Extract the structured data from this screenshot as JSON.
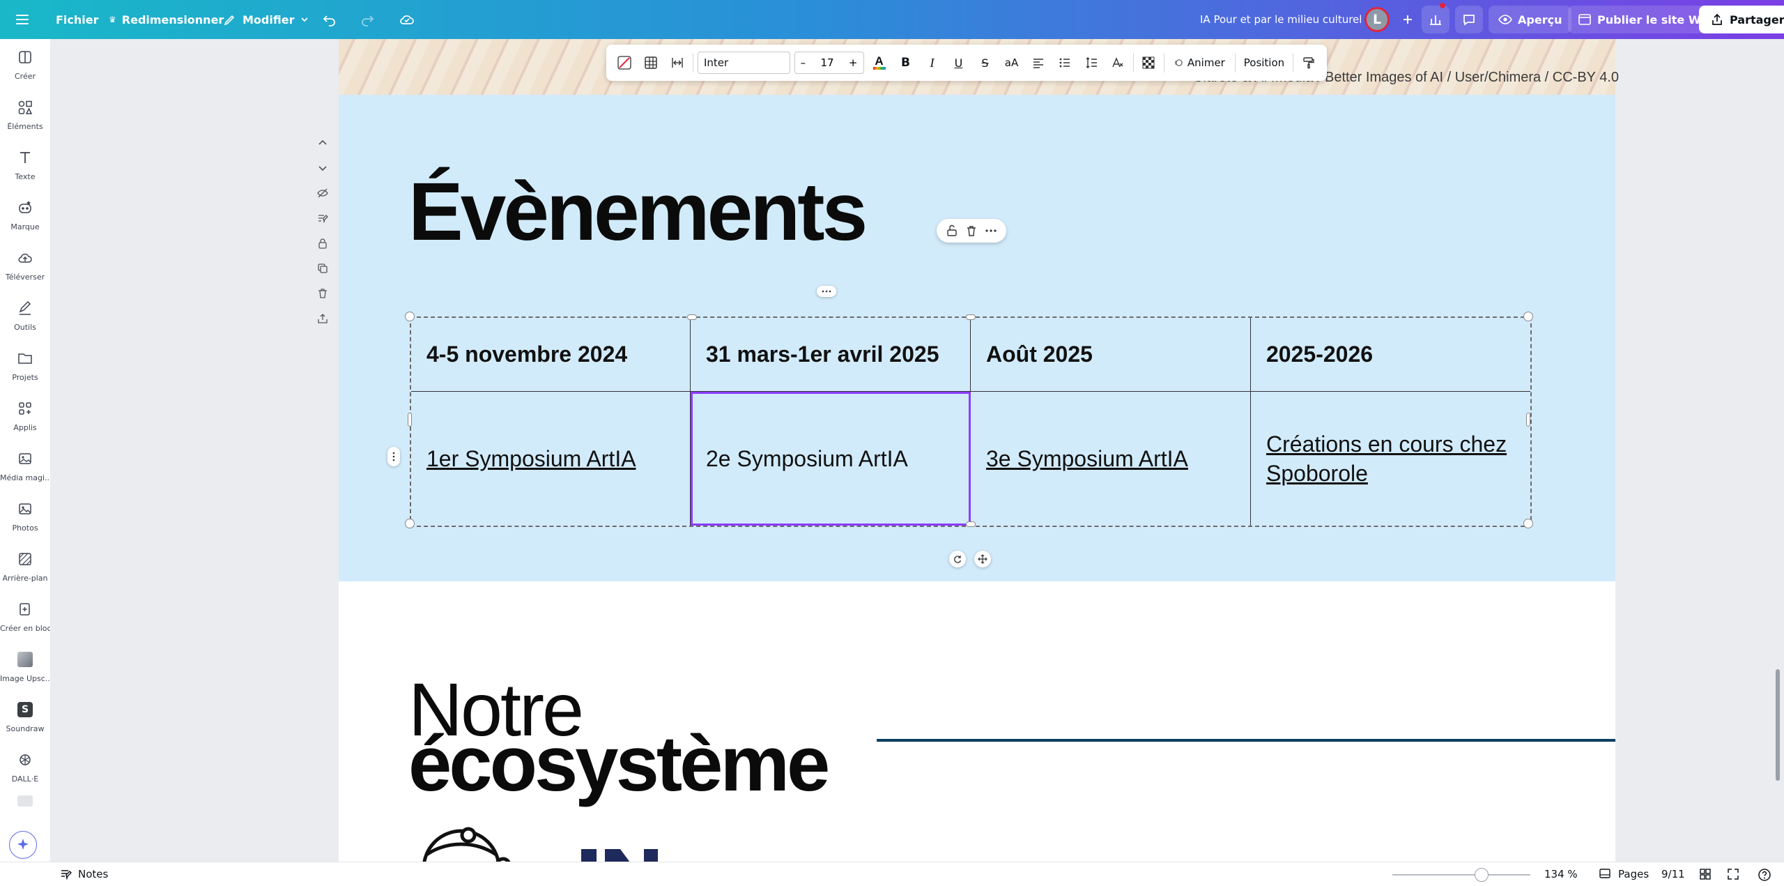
{
  "topbar": {
    "file": "Fichier",
    "resize": "Redimensionner",
    "edit": "Modifier",
    "doc_title": "IA Pour et par le milieu culturel",
    "avatar_letter": "L",
    "preview": "Aperçu",
    "publish": "Publier le site Web",
    "share": "Partager"
  },
  "sidebar": {
    "items": [
      {
        "label": "Créer",
        "icon": "create-icon"
      },
      {
        "label": "Éléments",
        "icon": "elements-icon"
      },
      {
        "label": "Texte",
        "icon": "text-icon"
      },
      {
        "label": "Marque",
        "icon": "brand-icon"
      },
      {
        "label": "Téléverser",
        "icon": "upload-icon"
      },
      {
        "label": "Outils",
        "icon": "draw-icon"
      },
      {
        "label": "Projets",
        "icon": "folder-icon"
      },
      {
        "label": "Applis",
        "icon": "apps-icon"
      },
      {
        "label": "Média magi...",
        "icon": "magic-media-icon"
      },
      {
        "label": "Photos",
        "icon": "photos-icon"
      },
      {
        "label": "Arrière-plan",
        "icon": "background-icon"
      },
      {
        "label": "Créer en bloc",
        "icon": "bulk-create-icon"
      },
      {
        "label": "Image Upsc...",
        "icon": "upscale-icon"
      },
      {
        "label": "Soundraw",
        "icon": "soundraw-icon"
      },
      {
        "label": "DALL·E",
        "icon": "dalle-icon"
      }
    ]
  },
  "toolbar": {
    "font": "Inter",
    "size": "17",
    "animate": "Animer",
    "position": "Position"
  },
  "canvas": {
    "credit": "Clarote & AI4Media / Better Images of AI / User/Chimera / CC-BY 4.0",
    "events_title": "Évènements",
    "table_head": [
      "4-5 novembre 2024",
      "31 mars-1er avril 2025",
      "Août 2025",
      "2025-2026"
    ],
    "table_body": [
      "1er Symposium ArtIA",
      "2e Symposium ArtIA",
      "3e Symposium ArtIA",
      "Créations en cours chez Spoborole"
    ],
    "eco_line1": "Notre",
    "eco_line2": "écosystème"
  },
  "bottombar": {
    "notes": "Notes",
    "zoom": "134 %",
    "pages": "Pages",
    "page_count": "9/11"
  },
  "colors": {
    "accent": "#8b3dff",
    "page_blue": "#d2ebfb",
    "avatar_ring": "#e0263f"
  }
}
